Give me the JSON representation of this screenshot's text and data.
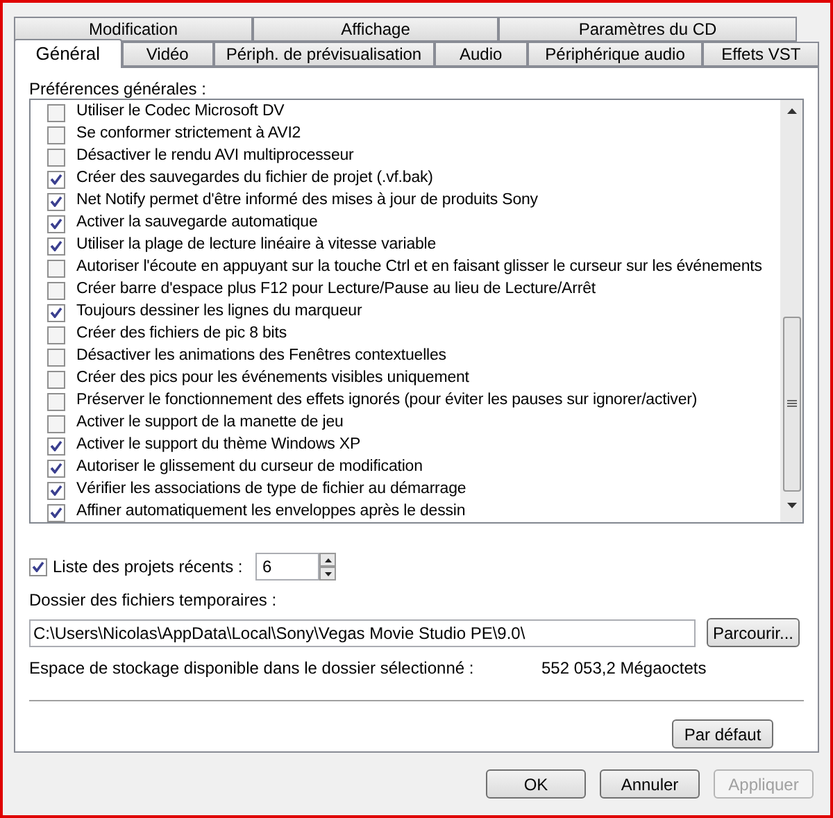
{
  "tab_rows": [
    [
      {
        "label": "Modification",
        "selected": false
      },
      {
        "label": "Affichage",
        "selected": false
      },
      {
        "label": "Paramètres du CD",
        "selected": false
      }
    ],
    [
      {
        "label": "Général",
        "selected": true
      },
      {
        "label": "Vidéo",
        "selected": false
      },
      {
        "label": "Périph. de prévisualisation",
        "selected": false
      },
      {
        "label": "Audio",
        "selected": false
      },
      {
        "label": "Périphérique audio",
        "selected": false
      },
      {
        "label": "Effets VST",
        "selected": false
      }
    ]
  ],
  "preferences": {
    "title": "Préférences générales :",
    "items": [
      {
        "label": "Utiliser le Codec Microsoft DV",
        "checked": false
      },
      {
        "label": "Se conformer strictement à AVI2",
        "checked": false
      },
      {
        "label": "Désactiver le rendu AVI multiprocesseur",
        "checked": false
      },
      {
        "label": "Créer des sauvegardes du fichier de projet (.vf.bak)",
        "checked": true
      },
      {
        "label": "Net Notify permet d'être informé des mises à jour de produits Sony",
        "checked": true
      },
      {
        "label": "Activer la sauvegarde automatique",
        "checked": true
      },
      {
        "label": "Utiliser la plage de lecture linéaire à vitesse variable",
        "checked": true
      },
      {
        "label": "Autoriser l'écoute en appuyant sur la touche Ctrl et en faisant glisser le curseur sur les événements",
        "checked": false
      },
      {
        "label": "Créer barre d'espace plus F12 pour Lecture/Pause au lieu de Lecture/Arrêt",
        "checked": false
      },
      {
        "label": "Toujours dessiner les lignes du marqueur",
        "checked": true
      },
      {
        "label": "Créer des fichiers de pic 8 bits",
        "checked": false
      },
      {
        "label": "Désactiver les animations des Fenêtres contextuelles",
        "checked": false
      },
      {
        "label": "Créer des pics pour les événements visibles uniquement",
        "checked": false
      },
      {
        "label": "Préserver le fonctionnement des effets ignorés (pour éviter les pauses sur ignorer/activer)",
        "checked": false
      },
      {
        "label": "Activer le support de la manette de jeu",
        "checked": false
      },
      {
        "label": "Activer le support du thème Windows XP",
        "checked": true
      },
      {
        "label": "Autoriser le glissement du curseur de modification",
        "checked": true
      },
      {
        "label": "Vérifier les associations de type de fichier au démarrage",
        "checked": true
      },
      {
        "label": "Affiner automatiquement les enveloppes après le dessin",
        "checked": true
      }
    ]
  },
  "recent_projects": {
    "label": "Liste des projets récents :",
    "checked": true,
    "value": "6"
  },
  "temp_folder": {
    "label": "Dossier des fichiers temporaires :",
    "value": "C:\\Users\\Nicolas\\AppData\\Local\\Sony\\Vegas Movie Studio PE\\9.0\\",
    "browse": "Parcourir..."
  },
  "storage": {
    "label": "Espace de stockage disponible dans le dossier sélectionné :",
    "value": "552 053,2 Mégaoctets"
  },
  "default_button": "Par défaut",
  "buttons": [
    {
      "label": "OK",
      "disabled": false
    },
    {
      "label": "Annuler",
      "disabled": false
    },
    {
      "label": "Appliquer",
      "disabled": true
    }
  ]
}
